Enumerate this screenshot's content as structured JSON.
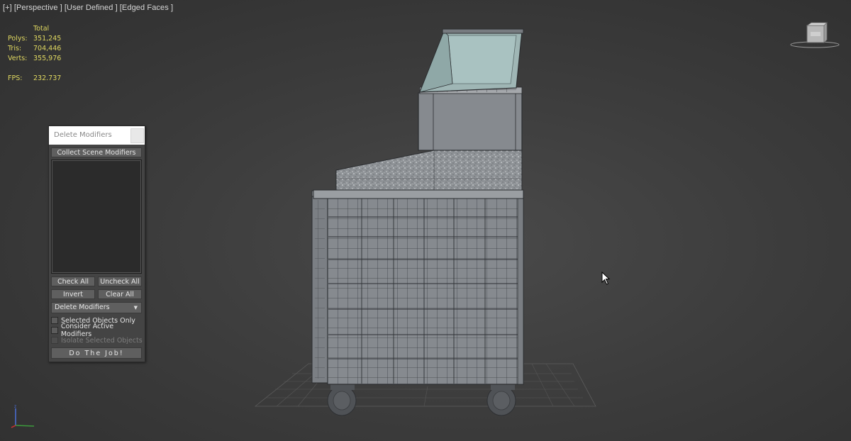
{
  "viewport": {
    "labels": [
      "[+]",
      "[Perspective ]",
      "[User Defined ]",
      "[Edged Faces ]"
    ]
  },
  "stats": {
    "header": "Total",
    "polys_label": "Polys:",
    "polys": "351,245",
    "tris_label": "Tris:",
    "tris": "704,446",
    "verts_label": "Verts:",
    "verts": "355,976",
    "fps_label": "FPS:",
    "fps": "232.737"
  },
  "panel": {
    "title": "Delete Modifiers",
    "collect_label": "Collect Scene Modifiers",
    "check_all": "Check All",
    "uncheck_all": "Uncheck All",
    "invert": "Invert",
    "clear_all": "Clear All",
    "mode_selected": "Delete Modifiers",
    "opt_selected_only": "Selected Objects Only",
    "opt_consider_active": "Consider Active Modifiers",
    "opt_isolate": "Isolate Selected Objects",
    "do_job": "Do The Job!"
  },
  "colors": {
    "stats_text": "#e0d860",
    "background": "#3d3d3d",
    "model_body": "#8a8d92",
    "glass": "#a8c0c0"
  },
  "icons": [
    "viewcube-icon",
    "axis-gizmo-icon",
    "mouse-cursor-icon",
    "chevron-down-icon",
    "close-icon"
  ]
}
